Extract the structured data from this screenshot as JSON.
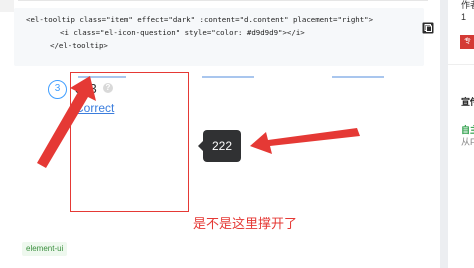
{
  "code": {
    "lines": [
      "<el-tooltip class=\"item\" effect=\"dark\" :content=\"d.content\" placement=\"right\">",
      "<i class=\"el-icon-question\" style=\"color: #d9d9d9\"></i>",
      "</el-tooltip>"
    ]
  },
  "step": {
    "number": "3"
  },
  "content": {
    "value": "333",
    "link": "Correct",
    "question_icon": "question-icon"
  },
  "tooltip": {
    "text": "222"
  },
  "annotation": {
    "text": "是不是这里撑开了"
  },
  "tag": {
    "label": "element-ui"
  },
  "sidebar": {
    "top": "作者",
    "top2": "1",
    "red_badge": "专栏",
    "section_title": "宣传",
    "green_text": "自主",
    "gray_text": "从F"
  },
  "colors": {
    "accent": "#409eff",
    "annotation_red": "#e53935",
    "tooltip_bg": "#303133",
    "link": "#3b7ddd",
    "tag_green": "#3a8f3e"
  }
}
